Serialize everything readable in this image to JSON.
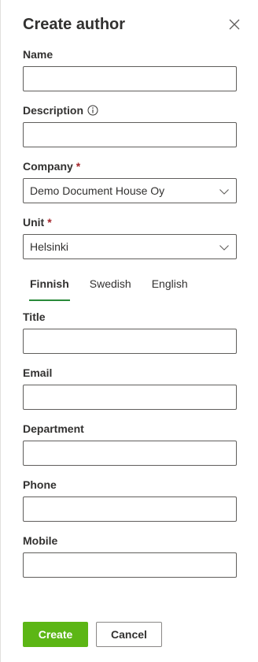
{
  "dialog": {
    "title": "Create author",
    "close_icon": "close-icon"
  },
  "fields": {
    "name": {
      "label": "Name",
      "value": ""
    },
    "description": {
      "label": "Description",
      "value": "",
      "icon": "info-icon"
    },
    "company": {
      "label": "Company",
      "required_mark": "*",
      "value": "Demo Document House Oy"
    },
    "unit": {
      "label": "Unit",
      "required_mark": "*",
      "value": "Helsinki"
    }
  },
  "tabs": [
    {
      "label": "Finnish",
      "active": true
    },
    {
      "label": "Swedish",
      "active": false
    },
    {
      "label": "English",
      "active": false
    }
  ],
  "localized_fields": {
    "title": {
      "label": "Title",
      "value": ""
    },
    "email": {
      "label": "Email",
      "value": ""
    },
    "department": {
      "label": "Department",
      "value": ""
    },
    "phone": {
      "label": "Phone",
      "value": ""
    },
    "mobile": {
      "label": "Mobile",
      "value": ""
    }
  },
  "footer": {
    "create_label": "Create",
    "cancel_label": "Cancel"
  },
  "colors": {
    "primary": "#5cb615",
    "tab_underline": "#2a8a3a",
    "required": "#a4262c"
  }
}
